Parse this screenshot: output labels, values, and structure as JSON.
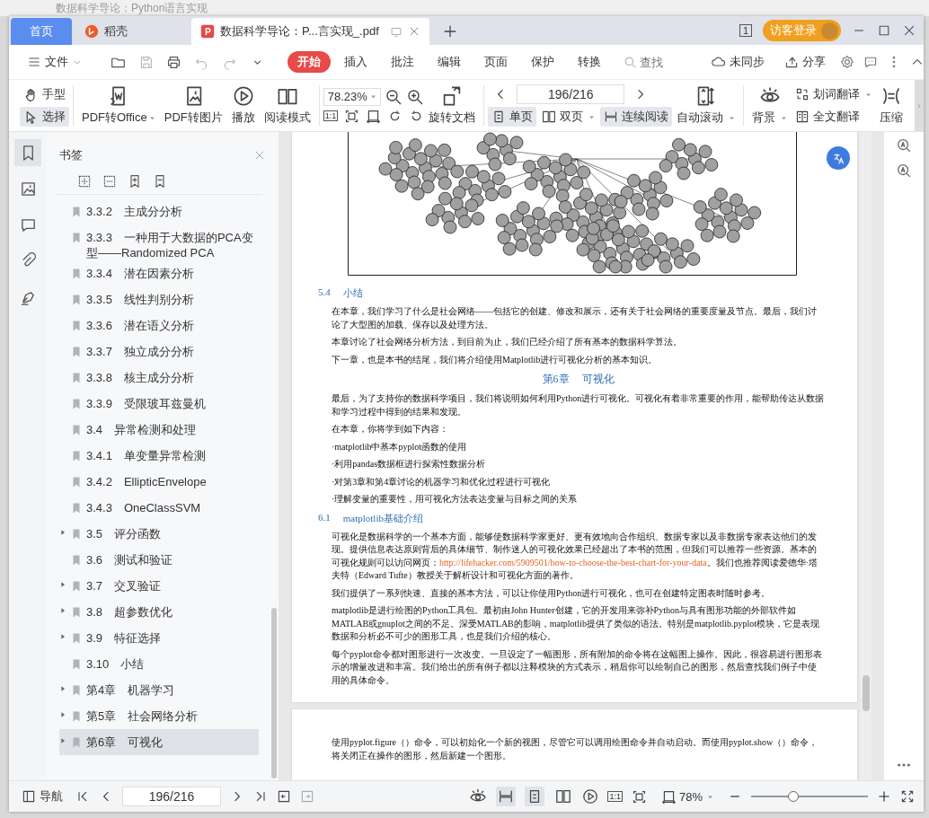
{
  "background_window": {
    "title": "数据科学导论：Python语言实现"
  },
  "tabs": [
    {
      "label": "首页",
      "kind": "home",
      "selected": false
    },
    {
      "label": "稻壳",
      "kind": "docer",
      "selected": false
    },
    {
      "label": "数据科学导论：P...言实现_.pdf",
      "kind": "pdf",
      "selected": true
    }
  ],
  "title_bar": {
    "window_count": "1",
    "login": "访客登录"
  },
  "menu": {
    "file": "文件",
    "tabs": [
      {
        "label": "开始",
        "selected": true
      },
      {
        "label": "插入",
        "selected": false
      },
      {
        "label": "批注",
        "selected": false
      },
      {
        "label": "编辑",
        "selected": false
      },
      {
        "label": "页面",
        "selected": false
      },
      {
        "label": "保护",
        "selected": false
      },
      {
        "label": "转换",
        "selected": false
      }
    ],
    "search": {
      "placeholder": "查找"
    },
    "sync": "未同步",
    "share": "分享"
  },
  "ribbon": {
    "pointer_tools": [
      {
        "label": "手型",
        "kind": "hand",
        "selected": false
      },
      {
        "label": "选择",
        "kind": "select",
        "selected": true
      }
    ],
    "convert": [
      {
        "label": "PDF转Office",
        "kind": "office",
        "dropdown": true
      },
      {
        "label": "PDF转图片",
        "kind": "image",
        "dropdown": false
      },
      {
        "label": "播放",
        "kind": "play",
        "dropdown": false
      },
      {
        "label": "阅读模式",
        "kind": "book",
        "dropdown": false
      }
    ],
    "zoom": {
      "value": "78.23%",
      "actual_size": "1:1"
    },
    "rotate": {
      "label": "旋转文档"
    },
    "page": {
      "value": "196/216"
    },
    "view_modes": [
      {
        "label": "单页",
        "kind": "single",
        "selected": true,
        "dropdown": false
      },
      {
        "label": "双页",
        "kind": "double",
        "selected": false,
        "dropdown": true
      },
      {
        "label": "连续阅读",
        "kind": "continuous",
        "selected": true,
        "dropdown": false
      }
    ],
    "auto_scroll": {
      "label": "自动滚动"
    },
    "background": {
      "label": "背景"
    },
    "translate": [
      {
        "label": "划词翻译",
        "kind": "word",
        "dropdown": true
      },
      {
        "label": "全文翻译",
        "kind": "full",
        "dropdown": false
      }
    ],
    "compress": {
      "label": "压缩"
    }
  },
  "sidebar": {
    "tabs": [
      {
        "kind": "bookmarks",
        "selected": true
      },
      {
        "kind": "thumbnails",
        "selected": false
      },
      {
        "kind": "comments",
        "selected": false
      },
      {
        "kind": "attachments",
        "selected": false
      },
      {
        "kind": "signature",
        "selected": false
      }
    ],
    "title": "书签",
    "items": [
      {
        "number": "3.3.2",
        "title": "主成分分析",
        "kind": "leaf",
        "selected": false
      },
      {
        "number": "3.3.3",
        "title": "一种用于大数据的PCA变型——Randomized PCA",
        "kind": "leaf",
        "selected": false
      },
      {
        "number": "3.3.4",
        "title": "潜在因素分析",
        "kind": "leaf",
        "selected": false
      },
      {
        "number": "3.3.5",
        "title": "线性判别分析",
        "kind": "leaf",
        "selected": false
      },
      {
        "number": "3.3.6",
        "title": "潜在语义分析",
        "kind": "leaf",
        "selected": false
      },
      {
        "number": "3.3.7",
        "title": "独立成分分析",
        "kind": "leaf",
        "selected": false
      },
      {
        "number": "3.3.8",
        "title": "核主成分分析",
        "kind": "leaf",
        "selected": false
      },
      {
        "number": "3.3.9",
        "title": "受限玻耳兹曼机",
        "kind": "leaf",
        "selected": false
      },
      {
        "number": "3.4",
        "title": "异常检测和处理",
        "kind": "leaf",
        "selected": false
      },
      {
        "number": "3.4.1",
        "title": "单变量异常检测",
        "kind": "leaf",
        "selected": false
      },
      {
        "number": "3.4.2",
        "title": "EllipticEnvelope",
        "kind": "leaf",
        "selected": false
      },
      {
        "number": "3.4.3",
        "title": "OneClassSVM",
        "kind": "leaf",
        "selected": false
      },
      {
        "number": "3.5",
        "title": "评分函数",
        "kind": "branch",
        "expanded": false,
        "selected": false
      },
      {
        "number": "3.6",
        "title": "测试和验证",
        "kind": "leaf",
        "selected": false
      },
      {
        "number": "3.7",
        "title": "交叉验证",
        "kind": "branch",
        "expanded": false,
        "selected": false
      },
      {
        "number": "3.8",
        "title": "超参数优化",
        "kind": "branch",
        "expanded": false,
        "selected": false
      },
      {
        "number": "3.9",
        "title": "特征选择",
        "kind": "branch",
        "expanded": false,
        "selected": false
      },
      {
        "number": "3.10",
        "title": "小结",
        "kind": "leaf",
        "selected": false
      },
      {
        "number": "第4章",
        "title": "机器学习",
        "kind": "branch",
        "expanded": false,
        "selected": false
      },
      {
        "number": "第5章",
        "title": "社会网络分析",
        "kind": "branch",
        "expanded": false,
        "selected": false
      },
      {
        "number": "第6章",
        "title": "可视化",
        "kind": "branch",
        "expanded": false,
        "selected": true
      }
    ]
  },
  "document": {
    "pages": [
      {
        "blocks": [
          {
            "kind": "figure"
          },
          {
            "kind": "heading",
            "number": "5.4",
            "title": "小结"
          },
          {
            "kind": "paragraph",
            "text": "在本章，我们学习了什么是社会网络——包括它的创建、修改和展示，还有关于社会网络的重要度量及节点。最后，我们讨论了大型图的加载、保存以及处理方法。"
          },
          {
            "kind": "paragraph",
            "text": "本章讨论了社会网络分析方法，到目前为止，我们已经介绍了所有基本的数据科学算法。"
          },
          {
            "kind": "paragraph",
            "text": "下一章，也是本书的结尾，我们将介绍使用Matplotlib进行可视化分析的基本知识。"
          },
          {
            "kind": "chapter",
            "number": "第6章",
            "title": "可视化"
          },
          {
            "kind": "paragraph",
            "text": "最后，为了支持你的数据科学项目，我们将说明如何利用Python进行可视化。可视化有着非常重要的作用，能帮助传达从数据和学习过程中得到的结果和发现。"
          },
          {
            "kind": "paragraph",
            "text": "在本章，你将学到如下内容："
          },
          {
            "kind": "paragraph",
            "text": "·matplotlib中基本pyplot函数的使用"
          },
          {
            "kind": "paragraph",
            "text": "·利用pandas数据框进行探索性数据分析"
          },
          {
            "kind": "paragraph",
            "text": "·对第3章和第4章讨论的机器学习和优化过程进行可视化"
          },
          {
            "kind": "paragraph",
            "text": "·理解变量的重要性，用可视化方法表达变量与目标之间的关系"
          },
          {
            "kind": "heading",
            "number": "6.1",
            "title": "matplotlib基础介绍"
          },
          {
            "kind": "link_paragraph",
            "text": "可视化是数据科学的一个基本方面，能够使数据科学家更好、更有效地向合作组织、数据专家以及非数据专家表达他们的发现。提供信息表达原则背后的具体细节、制作迷人的可视化效果已经超出了本书的范围，但我们可以推荐一些资源。基本的可视化规则可以访问网页：",
            "link": "http://lifehacker.com/5909501/how-to-choose-the-best-chart-for-your-data",
            "after": "。我们也推荐阅读爱德华·塔夫特（Edward Tufte）教授关于解析设计和可视化方面的著作。"
          },
          {
            "kind": "paragraph",
            "text": "我们提供了一系列快速、直接的基本方法，可以让你使用Python进行可视化，也可在创建特定图表时随时参考。"
          },
          {
            "kind": "paragraph",
            "text": "matplotlib是进行绘图的Python工具包。最初由John Hunter创建，它的开发用来弥补Python与具有图形功能的外部软件如MATLAB或gnuplot之间的不足。深受MATLAB的影响，matplotlib提供了类似的语法。特别是matplotlib.pyplot模块，它是表现数据和分析必不可少的图形工具，也是我们介绍的核心。"
          },
          {
            "kind": "paragraph",
            "text": "每个pyplot命令都对图形进行一次改变。一旦设定了一幅图形，所有附加的命令将在这幅图上操作。因此，很容易进行图形表示的增量改进和丰富。我们给出的所有例子都以注释模块的方式表示，稍后你可以绘制自己的图形，然后查找我们例子中使用的具体命令。"
          }
        ]
      },
      {
        "blocks": [
          {
            "kind": "paragraph",
            "text": "使用pyplot.figure（）命令，可以初始化一个新的视图，尽管它可以调用绘图命令并自动启动。而使用pyplot.show（）命令，将关闭正在操作的图形，然后新建一个图形。"
          }
        ]
      }
    ]
  },
  "status_bar": {
    "navigation": "导航",
    "page": "196/216",
    "actual_size": "1:1",
    "view_modes": [
      {
        "kind": "continuous",
        "selected": true
      },
      {
        "kind": "single",
        "selected": true
      },
      {
        "kind": "double",
        "selected": false
      }
    ],
    "zoom": "78%",
    "zoom_slider": {
      "level": 0.36
    }
  }
}
